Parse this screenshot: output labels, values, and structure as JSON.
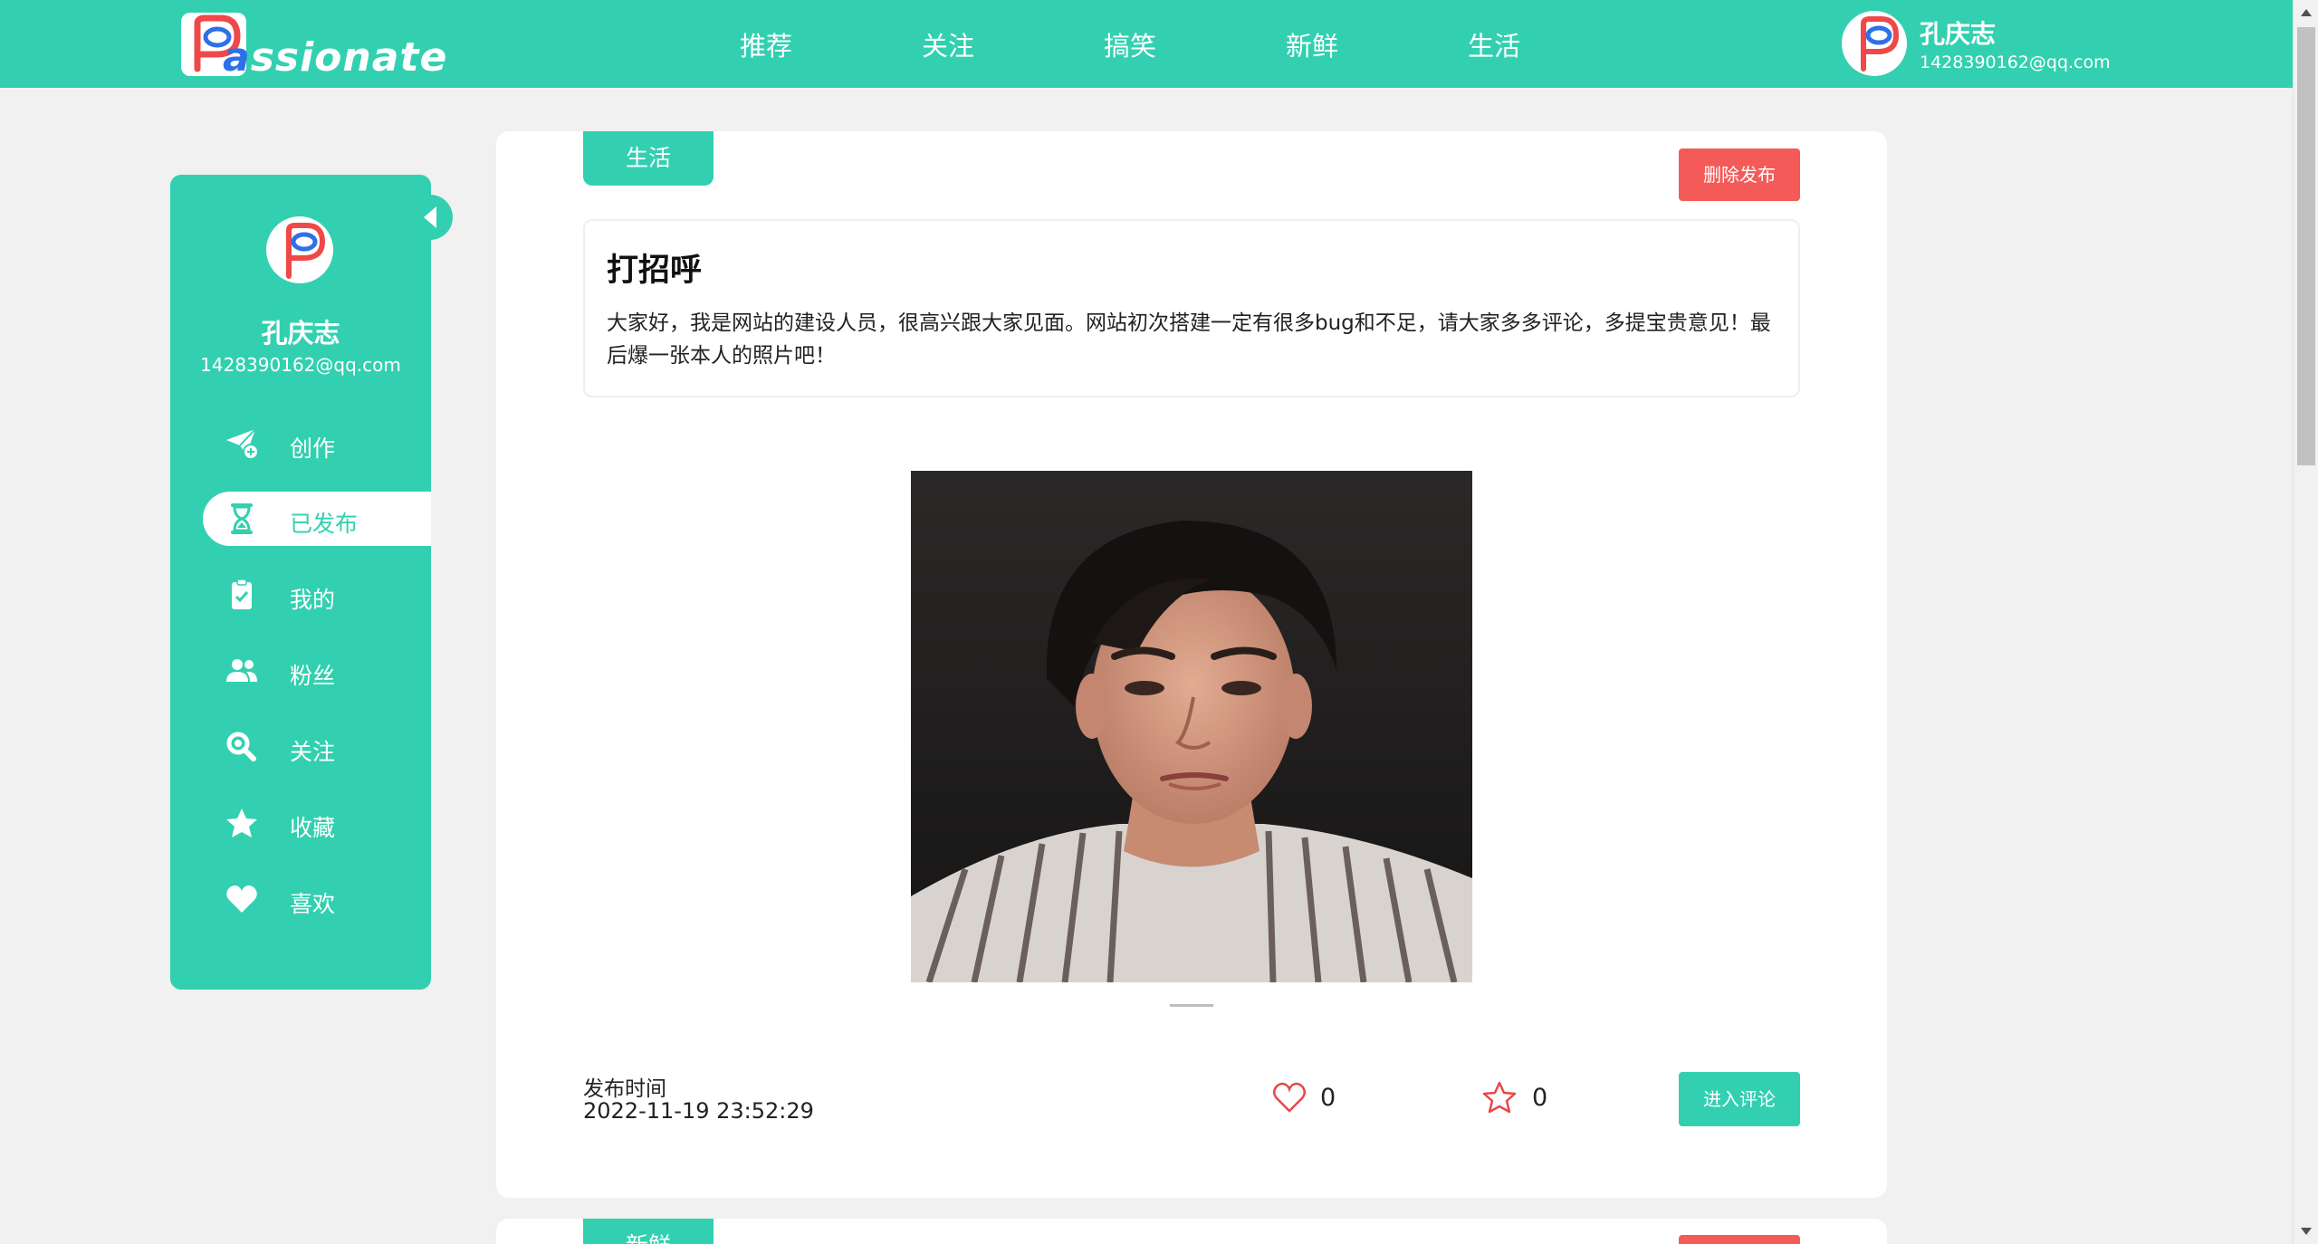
{
  "colors": {
    "brand": "#32d0b0",
    "danger": "#f45a58",
    "background": "#f1f1f1",
    "card": "#ffffff"
  },
  "header": {
    "logo_initial": "P",
    "logo_text_accent": "a",
    "logo_text_rest": "ssionate",
    "nav": [
      "推荐",
      "关注",
      "搞笑",
      "新鲜",
      "生活"
    ],
    "user_name": "孔庆志",
    "user_email": "1428390162@qq.com"
  },
  "sidebar": {
    "user_name": "孔庆志",
    "user_email": "1428390162@qq.com",
    "items": [
      {
        "label": "创作",
        "icon": "paper-plane-plus-icon"
      },
      {
        "label": "已发布",
        "icon": "hourglass-icon",
        "active": true
      },
      {
        "label": "我的",
        "icon": "clipboard-check-icon"
      },
      {
        "label": "粉丝",
        "icon": "users-icon"
      },
      {
        "label": "关注",
        "icon": "search-icon"
      },
      {
        "label": "收藏",
        "icon": "star-icon"
      },
      {
        "label": "喜欢",
        "icon": "heart-icon"
      }
    ]
  },
  "post": {
    "category": "生活",
    "delete_label": "删除发布",
    "title": "打招呼",
    "body": "大家好，我是网站的建设人员，很高兴跟大家见面。网站初次搭建一定有很多bug和不足，请大家多多评论，多提宝贵意见！最后爆一张本人的照片吧！",
    "time_label": "发布时间",
    "time": "2022-11-19 23:52:29",
    "likes": "0",
    "favorites": "0",
    "comment_label": "进入评论"
  },
  "next_post": {
    "category": "新鲜"
  }
}
